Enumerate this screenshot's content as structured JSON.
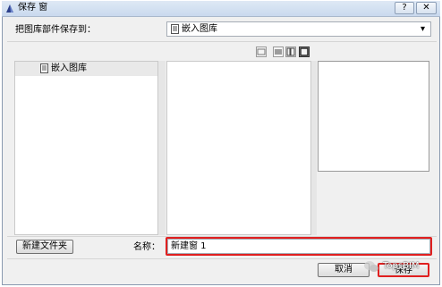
{
  "window": {
    "title": "保存 窗",
    "help_label": "?",
    "close_label": "✕"
  },
  "save_to": {
    "label": "把图库部件保存到：",
    "selected": "嵌入图库",
    "dropdown_arrow": "▾"
  },
  "tree": {
    "items": [
      {
        "label": "嵌入图库",
        "icon": "library-icon"
      }
    ]
  },
  "view_buttons": [
    "view-icons-icon",
    "view-list-icon",
    "view-details-icon",
    "view-preview-icon"
  ],
  "footer": {
    "new_folder_label": "新建文件夹",
    "name_label": "名称：",
    "name_value": "新建窗 1",
    "cancel_label": "取消",
    "save_label": "保存"
  },
  "watermark": {
    "text": "TopsBIM"
  },
  "colors": {
    "highlight_border": "#e02020",
    "titlebar": "#cfdcee"
  }
}
